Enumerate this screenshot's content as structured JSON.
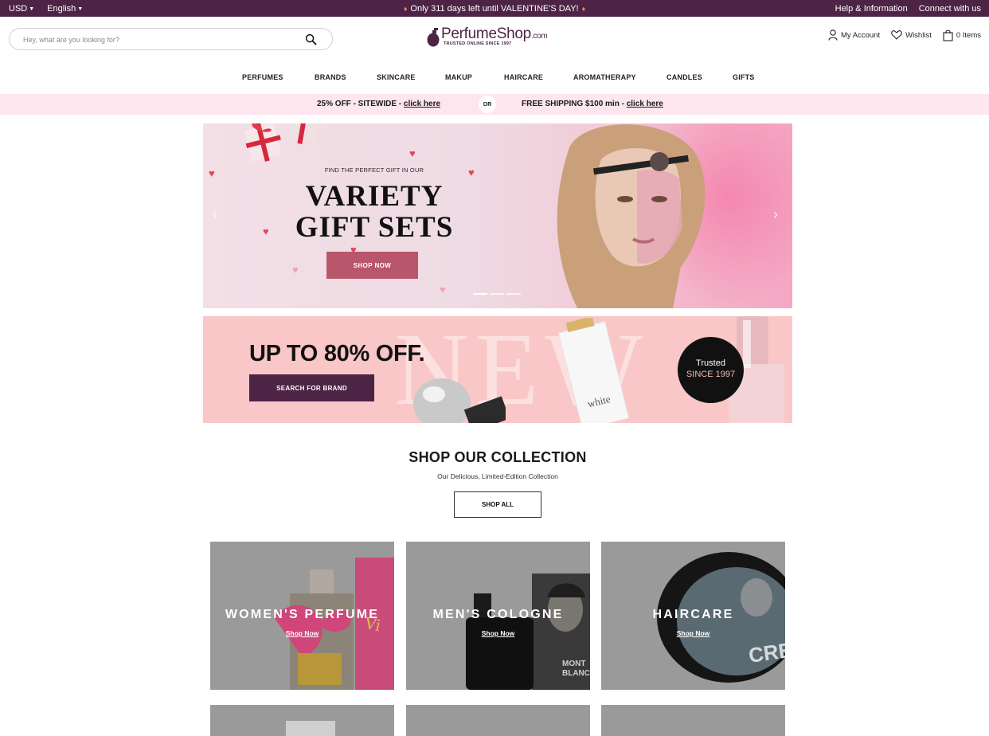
{
  "topbar": {
    "currency": "USD",
    "language": "English",
    "announcement": "Only 311 days left until VALENTINE'S DAY!",
    "help": "Help & Information",
    "connect": "Connect with us"
  },
  "search": {
    "placeholder": "Hey, what are you looking for?"
  },
  "logo": {
    "name": "PerfumeShop",
    "domain": ".com",
    "tagline": "TRUSTED ONLINE SINCE 1997"
  },
  "header_actions": {
    "account": "My Account",
    "wishlist": "Wishlist",
    "cart": "0 Items"
  },
  "nav": [
    "PERFUMES",
    "BRANDS",
    "SKINCARE",
    "MAKUP",
    "HAIRCARE",
    "AROMATHERAPY",
    "CANDLES",
    "GIFTS"
  ],
  "promo": {
    "offer1": "25% OFF - SITEWIDE - ",
    "offer1_link": "click here",
    "separator": "OR",
    "offer2": "FREE SHIPPING $100 min - ",
    "offer2_link": "click here"
  },
  "hero": {
    "kicker": "FIND THE PERFECT GIFT IN OUR",
    "line1": "VARIETY",
    "line2": "GIFT SETS",
    "cta": "SHOP NOW",
    "slide_count": 3,
    "active_slide": 1
  },
  "sale_banner": {
    "headline": "UP TO 80% OFF.",
    "cta": "SEARCH FOR BRAND",
    "background_word": "NEW",
    "badge_line1": "Trusted",
    "badge_line2": "SINCE 1997"
  },
  "collection": {
    "title": "SHOP OUR COLLECTION",
    "subtitle": "Our Delicious, Limited-Edition Collection",
    "cta": "SHOP ALL",
    "tiles": [
      {
        "label": "WOMEN'S PERFUME",
        "link": "Shop Now"
      },
      {
        "label": "MEN'S COLOGNE",
        "link": "Shop Now"
      },
      {
        "label": "HAIRCARE",
        "link": "Shop Now"
      }
    ]
  },
  "colors": {
    "brand": "#4d2446",
    "promo_bg": "#fde6ee",
    "hero_cta": "#b9566b",
    "sale_bg": "#f9c7c7"
  }
}
